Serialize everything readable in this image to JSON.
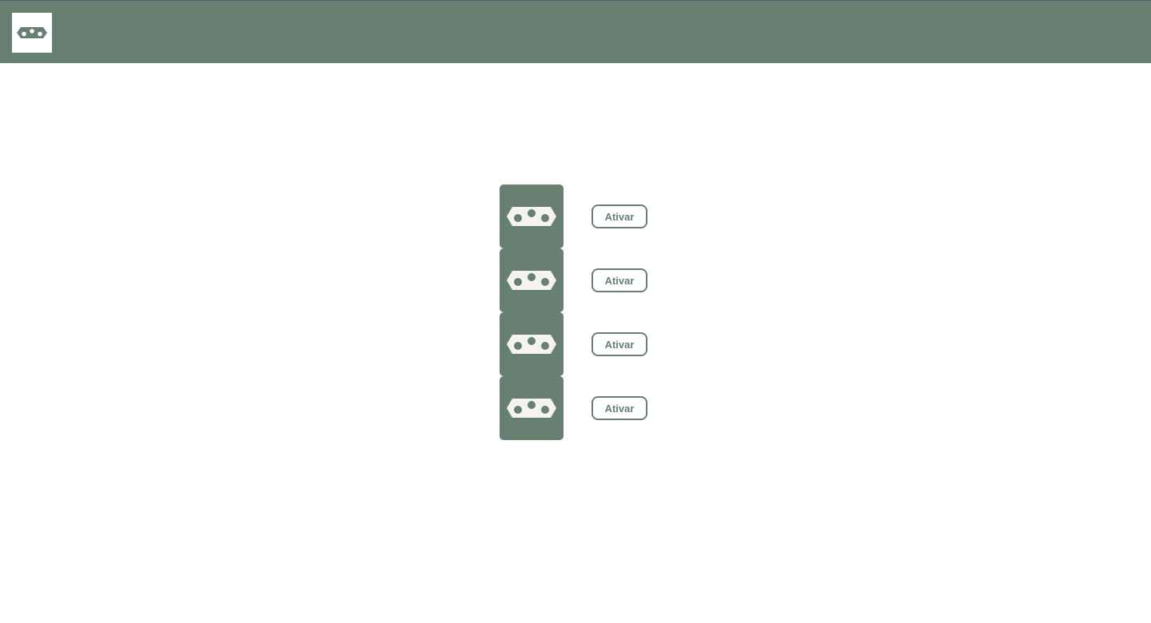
{
  "header": {
    "logo_icon": "power-outlet-icon"
  },
  "outlets": [
    {
      "icon": "power-outlet-icon",
      "button_label": "Ativar"
    },
    {
      "icon": "power-outlet-icon",
      "button_label": "Ativar"
    },
    {
      "icon": "power-outlet-icon",
      "button_label": "Ativar"
    },
    {
      "icon": "power-outlet-icon",
      "button_label": "Ativar"
    }
  ],
  "colors": {
    "primary": "#688072",
    "outlet_face": "#f5f3f0",
    "background": "#ffffff"
  }
}
